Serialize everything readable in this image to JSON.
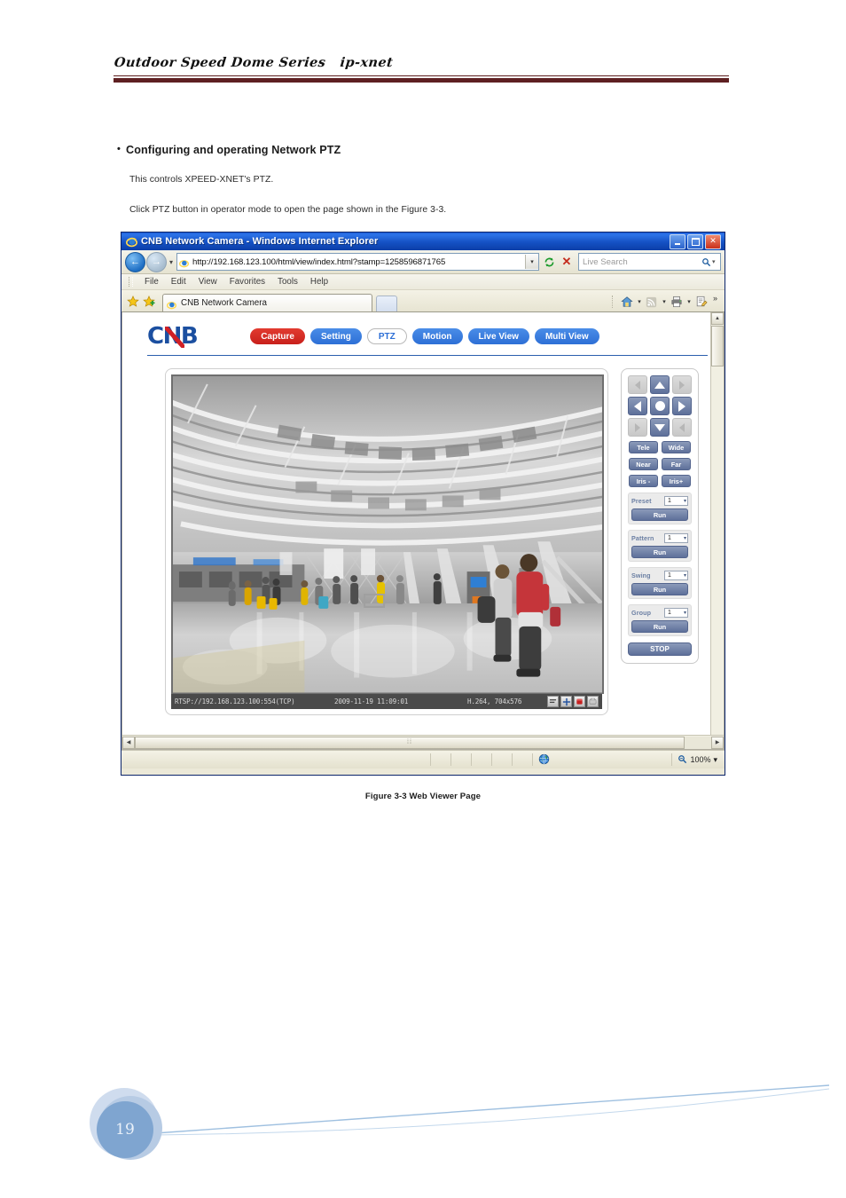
{
  "document": {
    "header_title": "Outdoor Speed Dome Series   ip-xnet",
    "page_number": "19",
    "section_bullet": "•",
    "section_title": "Configuring and operating Network PTZ",
    "paragraph_1": "This controls XPEED-XNET's PTZ.",
    "paragraph_2": "Click PTZ button in operator mode to open the page shown in the Figure 3-3.",
    "figure_caption": "Figure 3-3 Web Viewer Page"
  },
  "browser": {
    "title": "CNB Network Camera - Windows Internet Explorer",
    "window_buttons": {
      "minimize": "_",
      "maximize": "□",
      "close": "✕"
    },
    "address": {
      "url": "http://192.168.123.100/html/view/index.html?stamp=1258596871765",
      "dropdown_caret": "▾",
      "refresh": "↻",
      "stop": "✕"
    },
    "search": {
      "placeholder": "Live Search",
      "icon": "search-icon",
      "caret": "▾"
    },
    "menu": [
      "File",
      "Edit",
      "View",
      "Favorites",
      "Tools",
      "Help"
    ],
    "tab": {
      "label": "CNB Network Camera"
    },
    "toolbar_overflow": "»",
    "status": {
      "zone": "Internet",
      "zoom": "100%",
      "zoom_caret": "▾"
    }
  },
  "webpage": {
    "logo": {
      "c": "C",
      "n": "N",
      "b": "B"
    },
    "nav": [
      {
        "label": "Capture",
        "style": "red",
        "active": false
      },
      {
        "label": "Setting",
        "style": "blue",
        "active": false
      },
      {
        "label": "PTZ",
        "style": "white",
        "active": true
      },
      {
        "label": "Motion",
        "style": "blue",
        "active": false
      },
      {
        "label": "Live View",
        "style": "blue",
        "active": false
      },
      {
        "label": "Multi View",
        "style": "blue",
        "active": false
      }
    ],
    "video": {
      "stream_url": "RTSP://192.168.123.100:554(TCP)",
      "timestamp": "2009-11-19 11:09:01",
      "codec": "H.264, 704x576",
      "icons": [
        "aspect-icon",
        "pan-move-icon",
        "record-icon",
        "snapshot-icon"
      ],
      "scene_description": "Airport terminal interior with vaulted ceiling and travelers"
    },
    "ptz": {
      "dpad": {
        "up_left": "◤",
        "up": "▲",
        "up_right": "◥",
        "left": "◀",
        "center": "●",
        "right": "▶",
        "down_left": "◣",
        "down": "▼",
        "down_right": "◢"
      },
      "zoom_buttons": [
        {
          "left": "Tele",
          "right": "Wide"
        },
        {
          "left": "Near",
          "right": "Far"
        },
        {
          "left": "Iris -",
          "right": "Iris+"
        }
      ],
      "function_groups": [
        {
          "label": "Preset",
          "value": "1",
          "run": "Run"
        },
        {
          "label": "Pattern",
          "value": "1",
          "run": "Run"
        },
        {
          "label": "Swing",
          "value": "1",
          "run": "Run"
        },
        {
          "label": "Group",
          "value": "1",
          "run": "Run"
        }
      ],
      "stop": "STOP",
      "select_caret": "▾"
    }
  },
  "colors": {
    "header_rule": "#5e2022",
    "nav_red": "#c8201b",
    "nav_blue": "#2d6fd6",
    "ptz_button": "#5e709a",
    "logo_blue": "#1b4fa0",
    "titlebar_blue": "#1551c4",
    "page_circle": "#7fa5d0"
  }
}
